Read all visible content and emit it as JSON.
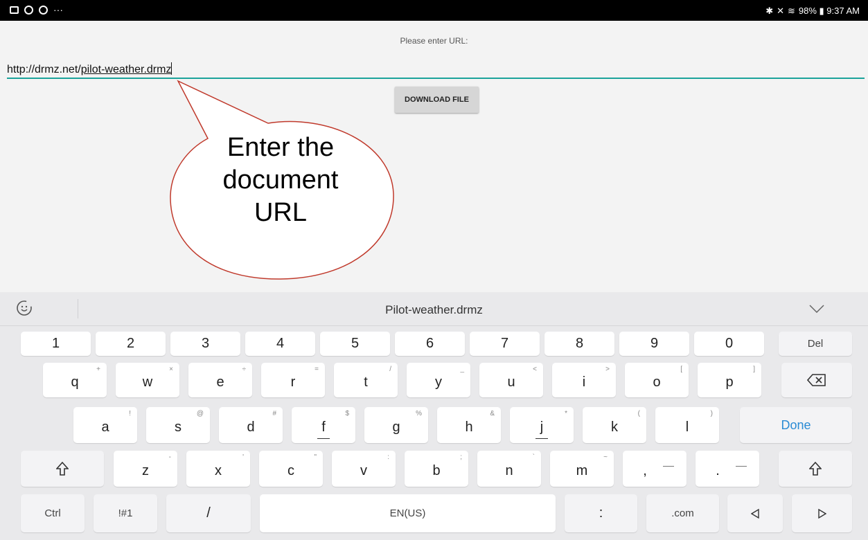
{
  "status_bar": {
    "right_text": "98% ▮ 9:37 AM",
    "bluetooth": "bluetooth-icon",
    "mute": "mute-icon",
    "wifi": "wifi-icon"
  },
  "app": {
    "prompt": "Please enter URL:",
    "url_prefix": "http://drmz.net/",
    "url_highlight": "pilot-weather.drmz",
    "download_label": "DOWNLOAD FILE",
    "accent_color": "#1aa39a"
  },
  "callout": {
    "line1": "Enter the",
    "line2": "document",
    "line3": "URL"
  },
  "keyboard": {
    "suggestion": "Pilot-weather.drmz",
    "numbers": [
      "1",
      "2",
      "3",
      "4",
      "5",
      "6",
      "7",
      "8",
      "9",
      "0"
    ],
    "del_label": "Del",
    "row_q": [
      {
        "k": "q",
        "h": "+"
      },
      {
        "k": "w",
        "h": "×"
      },
      {
        "k": "e",
        "h": "÷"
      },
      {
        "k": "r",
        "h": "="
      },
      {
        "k": "t",
        "h": "/"
      },
      {
        "k": "y",
        "h": "_"
      },
      {
        "k": "u",
        "h": "<"
      },
      {
        "k": "i",
        "h": ">"
      },
      {
        "k": "o",
        "h": "["
      },
      {
        "k": "p",
        "h": "]"
      }
    ],
    "row_a": [
      {
        "k": "a",
        "h": "!"
      },
      {
        "k": "s",
        "h": "@"
      },
      {
        "k": "d",
        "h": "#"
      },
      {
        "k": "f",
        "h": "$"
      },
      {
        "k": "g",
        "h": "%"
      },
      {
        "k": "h",
        "h": "&"
      },
      {
        "k": "j",
        "h": "*"
      },
      {
        "k": "k",
        "h": "("
      },
      {
        "k": "l",
        "h": ")"
      }
    ],
    "done_label": "Done",
    "row_z": [
      {
        "k": "z",
        "h": "-"
      },
      {
        "k": "x",
        "h": "'"
      },
      {
        "k": "c",
        "h": "\""
      },
      {
        "k": "v",
        "h": ":"
      },
      {
        "k": "b",
        "h": ";"
      },
      {
        "k": "n",
        "h": "`"
      },
      {
        "k": "m",
        "h": "~"
      }
    ],
    "comma": ",",
    "period": ".",
    "ctrl_label": "Ctrl",
    "sym_label": "!#1",
    "slash_label": "/",
    "space_label": "EN(US)",
    "colon_label": ":",
    "com_label": ".com"
  }
}
